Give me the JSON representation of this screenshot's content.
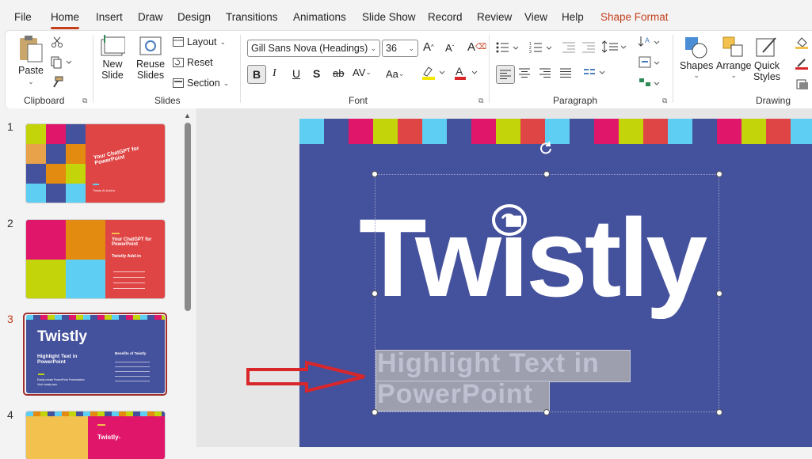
{
  "menu": {
    "tabs": [
      "File",
      "Home",
      "Insert",
      "Draw",
      "Design",
      "Transitions",
      "Animations",
      "Slide Show",
      "Record",
      "Review",
      "View",
      "Help",
      "Shape Format"
    ],
    "active": "Home"
  },
  "ribbon": {
    "clipboard": {
      "paste": "Paste",
      "group": "Clipboard"
    },
    "slides": {
      "new_slide": [
        "New",
        "Slide"
      ],
      "reuse_slides": [
        "Reuse",
        "Slides"
      ],
      "layout": "Layout",
      "reset": "Reset",
      "section": "Section",
      "group": "Slides"
    },
    "font": {
      "font_name": "Gill Sans Nova (Headings)",
      "font_size": "36",
      "group": "Font"
    },
    "paragraph": {
      "group": "Paragraph"
    },
    "drawing": {
      "shapes": "Shapes",
      "arrange": "Arrange",
      "quick_styles": [
        "Quick",
        "Styles"
      ],
      "group": "Drawing"
    }
  },
  "thumbnails": [
    {
      "number": "1",
      "title": "Your ChatGPT for PowerPoint",
      "caption": "Twisty AI Add-in"
    },
    {
      "number": "2",
      "title": "Your ChatGPT for PowerPoint",
      "subtitle": "Twistly Add-in"
    },
    {
      "number": "3",
      "title": "Twistly",
      "subtitle": "Highlight Text in PowerPoint",
      "right_title": "Benefits of Twistly",
      "caption": "Easily create PowerPoint Presentation",
      "caption2": "Visit: twistly.tech"
    },
    {
      "number": "4",
      "title": "Twistly-"
    }
  ],
  "slide": {
    "logo": "Twistly",
    "highlight_line1": "Highlight Text in",
    "highlight_line2": "PowerPoint"
  },
  "colors": {
    "accent": "#c43e1c",
    "slide_bg": "#44519c",
    "strip": [
      "#5ecff2",
      "#44519c",
      "#e0166a",
      "#c3d40a"
    ],
    "arrow": "#d9262b"
  }
}
